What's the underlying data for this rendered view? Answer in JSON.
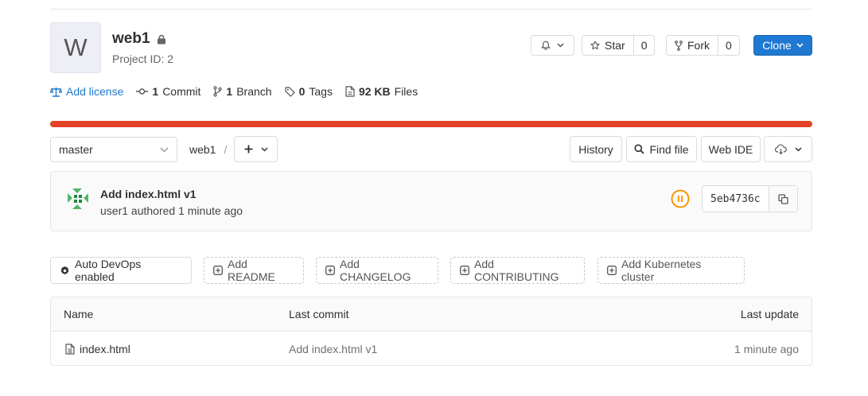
{
  "project": {
    "avatar_letter": "W",
    "name": "web1",
    "id_text": "Project ID: 2"
  },
  "actions": {
    "notification_icon": "bell-icon",
    "star_label": "Star",
    "star_count": "0",
    "fork_label": "Fork",
    "fork_count": "0",
    "clone_label": "Clone"
  },
  "stats": {
    "license_label": "Add license",
    "commits_count": "1",
    "commits_label": "Commit",
    "branches_count": "1",
    "branches_label": "Branch",
    "tags_count": "0",
    "tags_label": "Tags",
    "files_size": "92 KB",
    "files_label": "Files"
  },
  "repo": {
    "branch": "master",
    "path": "web1",
    "path_sep": "/",
    "history_label": "History",
    "find_file_label": "Find file",
    "web_ide_label": "Web IDE"
  },
  "last_commit": {
    "title": "Add index.html v1",
    "author": "user1",
    "authored": "authored",
    "time": "1 minute ago",
    "sha": "5eb4736c"
  },
  "quick_actions": {
    "auto_devops": "Auto DevOps enabled",
    "readme": "Add README",
    "changelog": "Add CHANGELOG",
    "contributing": "Add CONTRIBUTING",
    "kubernetes": "Add Kubernetes cluster"
  },
  "files_table": {
    "headers": {
      "name": "Name",
      "last_commit": "Last commit",
      "last_update": "Last update"
    },
    "rows": [
      {
        "name": "index.html",
        "last_commit": "Add index.html v1",
        "last_update": "1 minute ago"
      }
    ]
  },
  "colors": {
    "accent": "#1f78d1",
    "language_bar": "#e24329",
    "pipeline_running": "#fc9403"
  }
}
